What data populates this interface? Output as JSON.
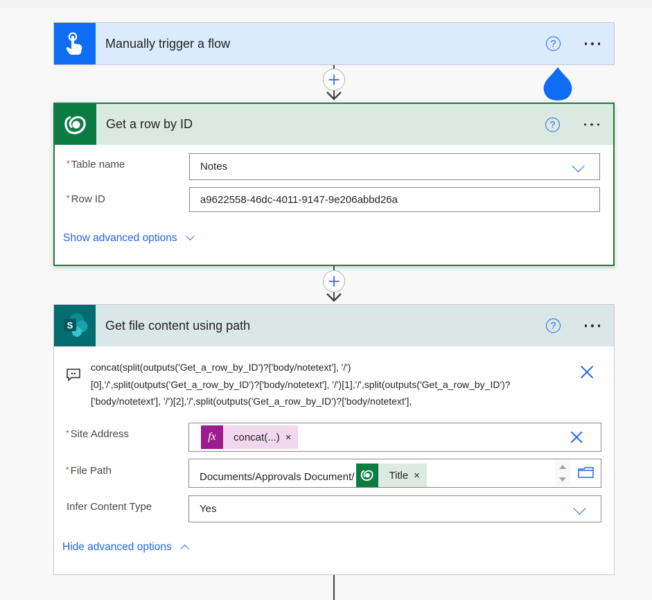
{
  "trigger": {
    "title": "Manually trigger a flow",
    "help_icon": "?",
    "icon": "touch-hand-icon"
  },
  "get_row": {
    "title": "Get a row by ID",
    "help_icon": "?",
    "icon": "dataverse-icon",
    "fields": {
      "table_name": {
        "label": "Table name",
        "required": "*",
        "value": "Notes"
      },
      "row_id": {
        "label": "Row ID",
        "required": "*",
        "value": "a9622558-46dc-4011-9147-9e206abbd26a"
      }
    },
    "advanced_link": "Show advanced options"
  },
  "sharepoint": {
    "title": "Get file content using path",
    "help_icon": "?",
    "icon": "sharepoint-icon",
    "expression_tooltip": {
      "line1": "concat(split(outputs('Get_a_row_by_ID')?['body/notetext'], '/')",
      "line2": "[0],'/',split(outputs('Get_a_row_by_ID')?['body/notetext'], '/')[1],'/',split(outputs('Get_a_row_by_ID')?",
      "line3": "['body/notetext'], '/')[2],'/',split(outputs('Get_a_row_by_ID')?['body/notetext'],"
    },
    "fields": {
      "site_address": {
        "label": "Site Address",
        "required": "*",
        "token_label": "concat(...)",
        "token_icon": "fx"
      },
      "file_path": {
        "label": "File Path",
        "required": "*",
        "prefix_text": "Documents/Approvals Document/",
        "token_label": "Title"
      },
      "infer_content_type": {
        "label": "Infer Content Type",
        "value": "Yes"
      }
    },
    "advanced_link": "Hide advanced options"
  },
  "token_remove": "×",
  "colors": {
    "accent": "#2266e3",
    "trigger_blue": "#0f6cf5",
    "dataverse_green": "#0a7c42",
    "sharepoint_teal": "#036c70",
    "fx_purple": "#9c1c8f"
  }
}
